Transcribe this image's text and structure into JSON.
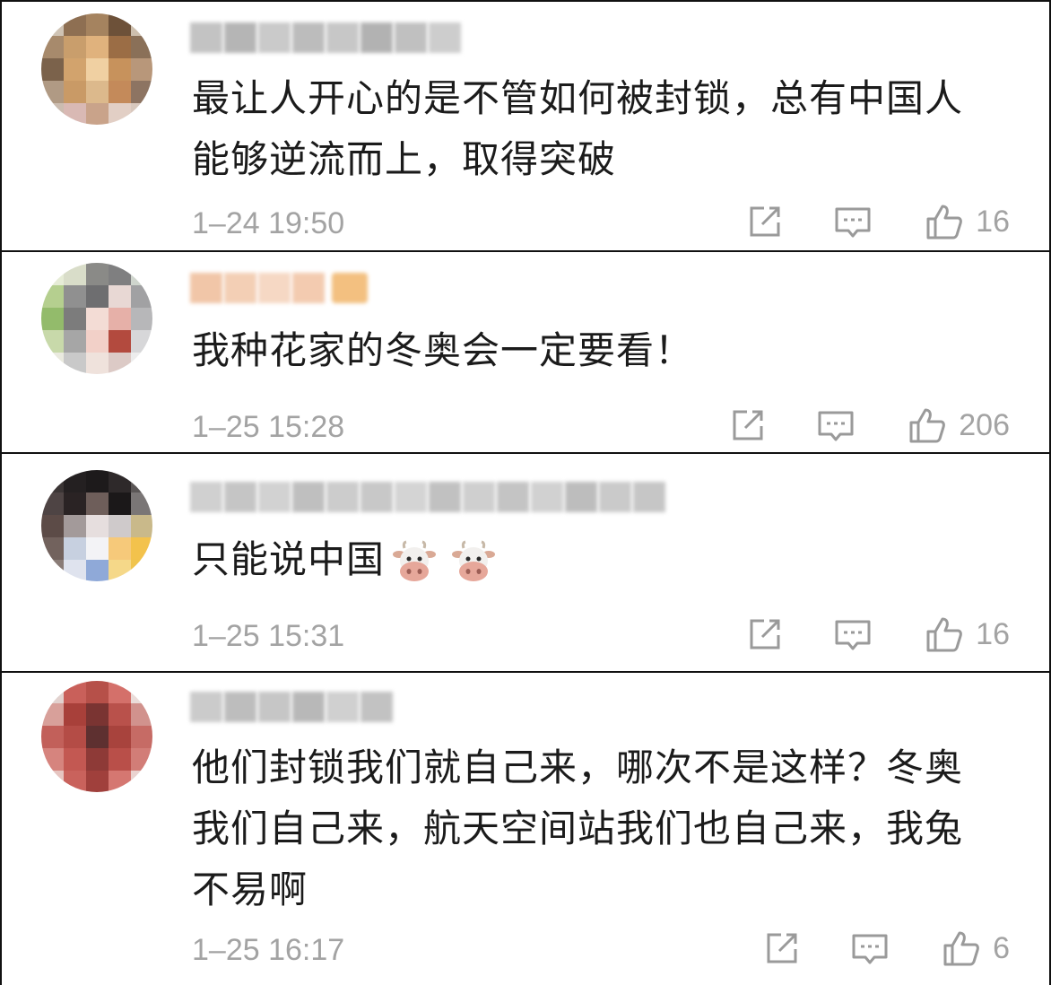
{
  "colors": {
    "text": "#1b1b1b",
    "meta": "#a3a3a3",
    "divider": "#111111"
  },
  "comments": [
    {
      "text_lines": [
        "最让人开心的是不管如何被封锁，总有中国人",
        "能够逆流而上，取得突破"
      ],
      "time": "1–24 19:50",
      "likes": "16",
      "avatar_icon": "pixelated-avatar-icon",
      "name_blurred": true
    },
    {
      "text_lines": [
        "我种花家的冬奥会一定要看！"
      ],
      "time": "1–25 15:28",
      "likes": "206",
      "avatar_icon": "pixelated-avatar-icon",
      "name_blurred": true
    },
    {
      "text_lines": [
        "只能说中国"
      ],
      "emojis": [
        "cow-face-emoji",
        "cow-face-emoji"
      ],
      "time": "1–25 15:31",
      "likes": "16",
      "avatar_icon": "pixelated-avatar-icon",
      "name_blurred": true
    },
    {
      "text_lines": [
        "他们封锁我们就自己来，哪次不是这样？冬奥",
        "我们自己来，航天空间站我们也自己来，我兔",
        "不易啊"
      ],
      "time": "1–25 16:17",
      "likes": "6",
      "avatar_icon": "pixelated-avatar-icon",
      "name_blurred": true
    }
  ],
  "icons": {
    "share": "share-icon",
    "reply": "reply-icon",
    "like": "thumbs-up-icon"
  }
}
